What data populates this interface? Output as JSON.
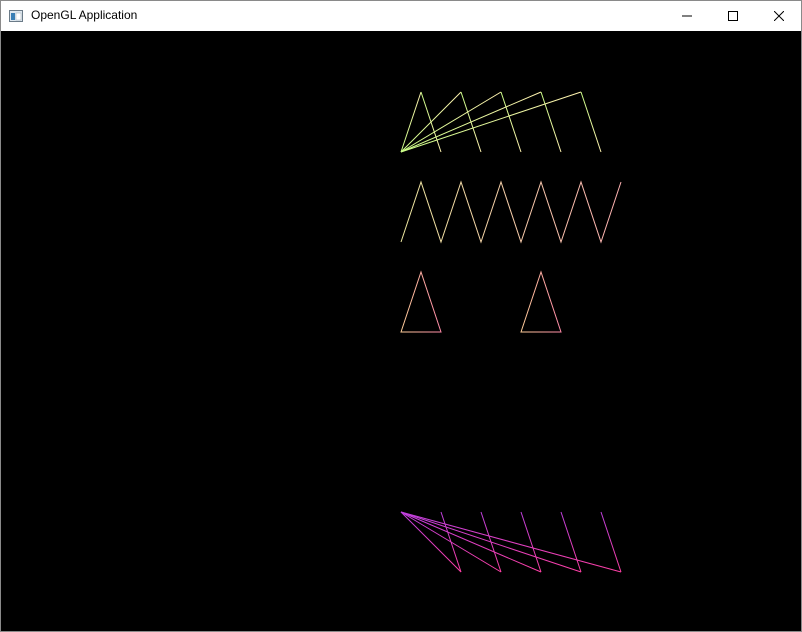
{
  "window": {
    "title": "OpenGL Application",
    "icon": "application-window-icon",
    "controls": {
      "minimize_icon": "minimize-icon",
      "maximize_icon": "maximize-icon",
      "close_icon": "close-icon"
    }
  },
  "canvas": {
    "background": "#000000",
    "rows": [
      {
        "name": "triangle-fan-row",
        "color": "#e6ffa0"
      },
      {
        "name": "triangle-strip-row",
        "color": "#ffd6a0"
      },
      {
        "name": "separate-triangles-row",
        "color": "#ff9ab0"
      },
      {
        "name": "magenta-fan-row",
        "color": "#ff3fb4"
      }
    ]
  }
}
